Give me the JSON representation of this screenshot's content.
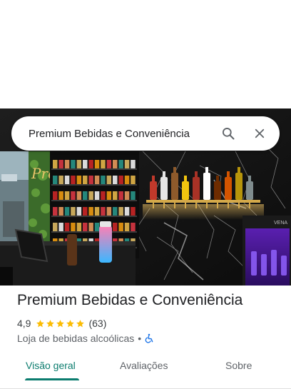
{
  "search": {
    "query": "Premium Bebidas e Conveniência",
    "search_icon": "search-icon",
    "close_icon": "close-icon"
  },
  "photo": {
    "storefront_text": "Premium",
    "fridge_label": "VENA"
  },
  "place": {
    "name": "Premium Bebidas e Conveniência",
    "rating": "4,9",
    "stars": 5,
    "review_count": "(63)",
    "category": "Loja de bebidas alcoólicas",
    "separator": "•",
    "accessibility_icon": "wheelchair-icon"
  },
  "tabs": [
    {
      "label": "Visão geral",
      "active": true
    },
    {
      "label": "Avaliações",
      "active": false
    },
    {
      "label": "Sobre",
      "active": false
    }
  ],
  "colors": {
    "accent": "#0b7c6e",
    "star": "#fbbc04",
    "accessibility": "#1a73e8"
  }
}
